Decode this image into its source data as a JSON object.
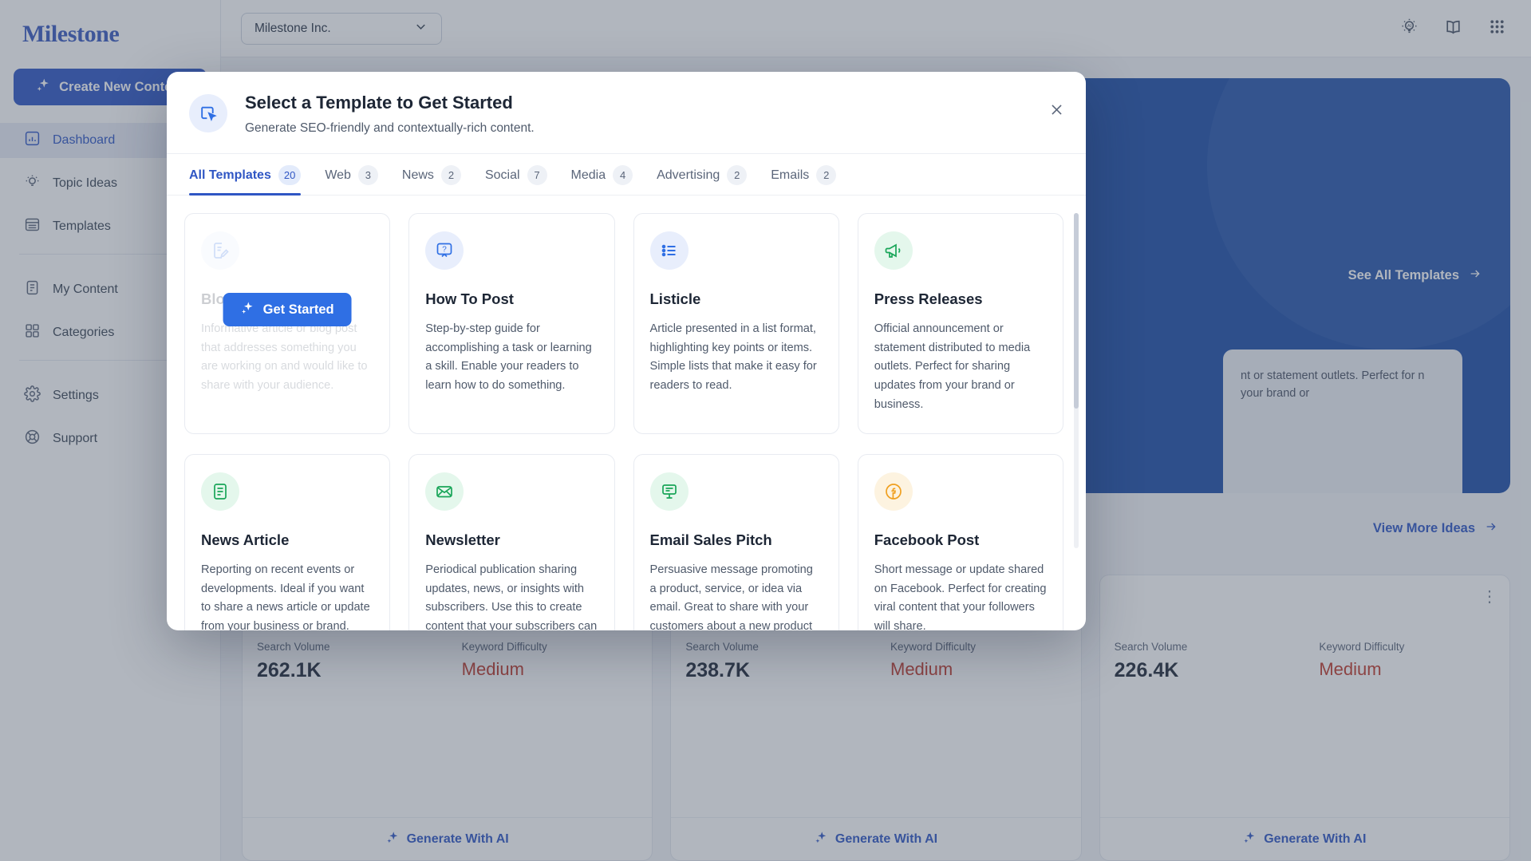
{
  "sidebar": {
    "brand": "Milestone",
    "create_button": "Create New Content",
    "items": [
      {
        "label": "Dashboard",
        "icon": "chart-bar-icon",
        "active": true
      },
      {
        "label": "Topic Ideas",
        "icon": "lightbulb-icon",
        "active": false
      },
      {
        "label": "Templates",
        "icon": "layout-list-icon",
        "active": false
      },
      {
        "label": "My Content",
        "icon": "document-icon",
        "active": false
      },
      {
        "label": "Categories",
        "icon": "grid-squares-icon",
        "active": false
      },
      {
        "label": "Settings",
        "icon": "gear-icon",
        "active": false
      },
      {
        "label": "Support",
        "icon": "lifebuoy-icon",
        "active": false
      }
    ]
  },
  "topbar": {
    "org_selector": "Milestone Inc.",
    "icons": [
      "ai-bulb-icon",
      "book-icon",
      "apps-grid-icon"
    ]
  },
  "background": {
    "hero_link": "See All Templates",
    "hero_card_text": "nt or statement outlets. Perfect for n your brand or",
    "more_ideas": "View More Ideas",
    "keyword_cards": [
      {
        "volume_label": "Search Volume",
        "volume": "262.1K",
        "difficulty_label": "Keyword Difficulty",
        "difficulty": "Medium",
        "action": "Generate With AI"
      },
      {
        "volume_label": "Search Volume",
        "volume": "238.7K",
        "difficulty_label": "Keyword Difficulty",
        "difficulty": "Medium",
        "action": "Generate With AI"
      },
      {
        "volume_label": "Search Volume",
        "volume": "226.4K",
        "difficulty_label": "Keyword Difficulty",
        "difficulty": "Medium",
        "action": "Generate With AI"
      }
    ]
  },
  "modal": {
    "title": "Select a Template to Get Started",
    "subtitle": "Generate SEO-friendly and contextually-rich content.",
    "close_label": "✕",
    "get_started_button": "Get Started",
    "tabs": [
      {
        "label": "All Templates",
        "count": "20",
        "active": true
      },
      {
        "label": "Web",
        "count": "3",
        "active": false
      },
      {
        "label": "News",
        "count": "2",
        "active": false
      },
      {
        "label": "Social",
        "count": "7",
        "active": false
      },
      {
        "label": "Media",
        "count": "4",
        "active": false
      },
      {
        "label": "Advertising",
        "count": "2",
        "active": false
      },
      {
        "label": "Emails",
        "count": "2",
        "active": false
      }
    ],
    "templates": [
      {
        "title": "Blog Post",
        "desc": "Informative article or blog post that addresses something you are working on and would like to share with your audience.",
        "icon": "document-edit-icon",
        "icon_color": "#2f6fe4",
        "icon_bg": "#e8eefc",
        "hovered": true
      },
      {
        "title": "How To Post",
        "desc": "Step-by-step guide for accomplishing a task or learning a skill. Enable your readers to learn how to do something.",
        "icon": "question-bubble-icon",
        "icon_color": "#2f6fe4",
        "icon_bg": "#e8eefc",
        "hovered": false
      },
      {
        "title": "Listicle",
        "desc": "Article presented in a list format, highlighting key points or items. Simple lists that make it easy for readers to read.",
        "icon": "bullet-list-icon",
        "icon_color": "#2f6fe4",
        "icon_bg": "#e8eefc",
        "hovered": false
      },
      {
        "title": "Press Releases",
        "desc": "Official announcement or statement distributed to media outlets. Perfect for sharing updates from your brand or business.",
        "icon": "megaphone-icon",
        "icon_color": "#18a558",
        "icon_bg": "#e4f7ec",
        "hovered": false
      },
      {
        "title": "News Article",
        "desc": "Reporting on recent events or developments. Ideal if you want to share a news article or update from your business or brand.",
        "icon": "news-document-icon",
        "icon_color": "#18a558",
        "icon_bg": "#e4f7ec",
        "hovered": false
      },
      {
        "title": "Newsletter",
        "desc": "Periodical publication sharing updates, news, or insights with subscribers. Use this to create content that your subscribers can read about your business.",
        "icon": "envelope-icon",
        "icon_color": "#18a558",
        "icon_bg": "#e4f7ec",
        "hovered": false
      },
      {
        "title": "Email Sales Pitch",
        "desc": "Persuasive message promoting a product, service, or idea via email. Great to share with your customers about a new product or service you are offering.",
        "icon": "email-pitch-icon",
        "icon_color": "#18a558",
        "icon_bg": "#e4f7ec",
        "hovered": false
      },
      {
        "title": "Facebook Post",
        "desc": "Short message or update shared on Facebook. Perfect for creating viral content that your followers will share.",
        "icon": "facebook-icon",
        "icon_color": "#f0a020",
        "icon_bg": "#fdf3e0",
        "hovered": false
      }
    ],
    "partial_row_icons": [
      {
        "icon": "social-icon",
        "icon_color": "#f0a020",
        "icon_bg": "#fdf3e0"
      },
      {
        "icon": "social-icon",
        "icon_color": "#f0a020",
        "icon_bg": "#fdf3e0"
      },
      {
        "icon": "social-icon",
        "icon_color": "#f0a020",
        "icon_bg": "#fdf3e0"
      },
      {
        "icon": "social-icon",
        "icon_color": "#f0a020",
        "icon_bg": "#fdf3e0"
      }
    ]
  },
  "colors": {
    "brand_blue": "#2f56c4",
    "accent_blue": "#2f6fe4",
    "green": "#18a558",
    "amber": "#f0a020",
    "danger_red": "#c0392b",
    "highlight_red": "#ff0000"
  }
}
